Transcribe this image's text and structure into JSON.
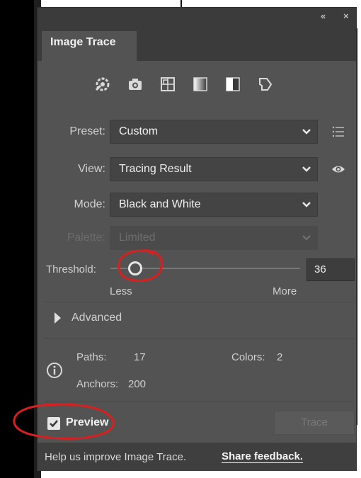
{
  "panel": {
    "tab_label": "Image Trace",
    "titlebar_icons": [
      "collapse-icon",
      "close-icon"
    ],
    "collapse_glyph": "«",
    "close_glyph": "×"
  },
  "preset_icons": [
    "auto-color-icon",
    "high-color-icon",
    "low-color-icon",
    "grayscale-icon",
    "black-and-white-icon",
    "outline-icon"
  ],
  "fields": {
    "preset": {
      "label": "Preset:",
      "value": "Custom"
    },
    "view": {
      "label": "View:",
      "value": "Tracing Result"
    },
    "mode": {
      "label": "Mode:",
      "value": "Black and White"
    },
    "palette": {
      "label": "Palette:",
      "value": "Limited",
      "disabled": true
    }
  },
  "threshold": {
    "label": "Threshold:",
    "value": "36",
    "slider_fraction": 0.13,
    "min_label": "Less",
    "max_label": "More"
  },
  "advanced": {
    "label": "Advanced"
  },
  "stats": {
    "paths_label": "Paths:",
    "paths_value": "17",
    "colors_label": "Colors:",
    "colors_value": "2",
    "anchors_label": "Anchors:",
    "anchors_value": "200"
  },
  "preview": {
    "label": "Preview",
    "checked": true
  },
  "trace_button": {
    "label": "Trace",
    "disabled": true
  },
  "footer": {
    "help_text": "Help us improve Image Trace.",
    "link_text": "Share feedback."
  },
  "colors": {
    "panel_bg": "#535353",
    "header_bg": "#3b3b3b",
    "field_bg": "#444444",
    "annotation_red": "#d91f1f"
  }
}
